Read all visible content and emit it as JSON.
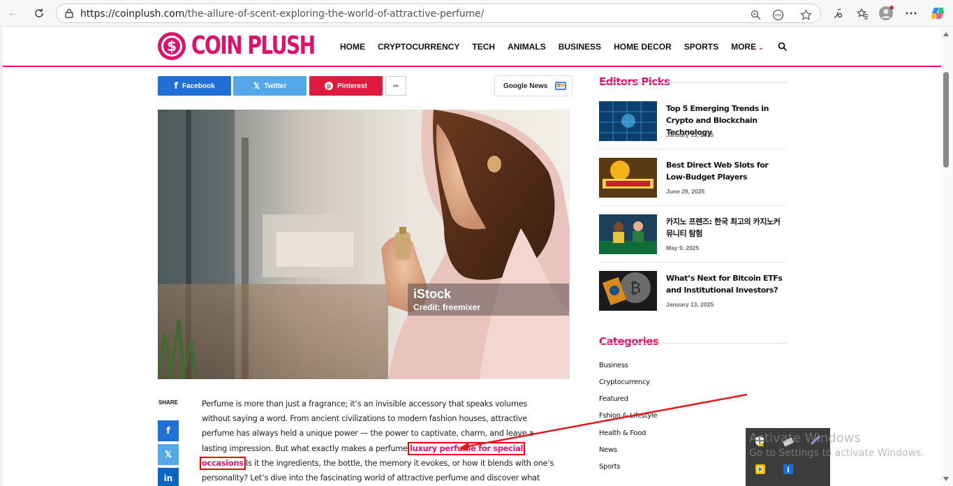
{
  "browser": {
    "url_main": "https://coinplush.com",
    "url_path": "/the-allure-of-scent-exploring-the-world-of-attractive-perfume/"
  },
  "site": {
    "logo_text": "COIN PLUSH",
    "logo_symbol": "$",
    "nav": [
      "HOME",
      "CRYPTOCURRENCY",
      "TECH",
      "ANIMALS",
      "BUSINESS",
      "HOME DECOR",
      "SPORTS",
      "MORE"
    ],
    "accent_color": "#e0116b"
  },
  "share": {
    "facebook": "Facebook",
    "twitter": "Twitter",
    "pinterest": "Pinterest",
    "google_news": "Google News",
    "share_label": "SHARE"
  },
  "hero": {
    "watermark": "iStock",
    "credit": "Credit: freemixer"
  },
  "article": {
    "text_before": "Perfume is more than just a fragrance; it’s an invisible accessory that speaks volumes without saying a word. From ancient civilizations to modern fashion houses, attractive perfume has always held a unique power — the power to captivate, charm, and leave a lasting impression. But what exactly makes a perfume ",
    "link_text": "luxury perfume for special occasions",
    "text_after": " Is it the ingredients, the bottle, the memory it evokes, or how it blends with one’s personality? Let’s dive into the fascinating world of attractive perfume and discover what makes certain scents irresistible."
  },
  "editors_picks": {
    "title": "Editors Picks",
    "items": [
      {
        "headline": "Top 5 Emerging Trends in Crypto and Blockchain Technology",
        "date": "January 13, 2025"
      },
      {
        "headline": "Best Direct Web Slots for Low-Budget Players",
        "date": "June 29, 2025"
      },
      {
        "headline": "카지노 프렌즈: 한국 최고의 카지노커뮤니티 탐험",
        "date": "May 9, 2025"
      },
      {
        "headline": "What’s Next for Bitcoin ETFs and Institutional Investors?",
        "date": "January 13, 2025"
      }
    ]
  },
  "categories": {
    "title": "Categories",
    "items": [
      "Business",
      "Cryptocurrency",
      "Featured",
      "Fshion & Lifestyle",
      "Health & Food",
      "News",
      "Sports"
    ]
  },
  "os_overlay": {
    "watermark_title": "Activate Windows",
    "watermark_sub": "Go to Settings to activate Windows."
  }
}
